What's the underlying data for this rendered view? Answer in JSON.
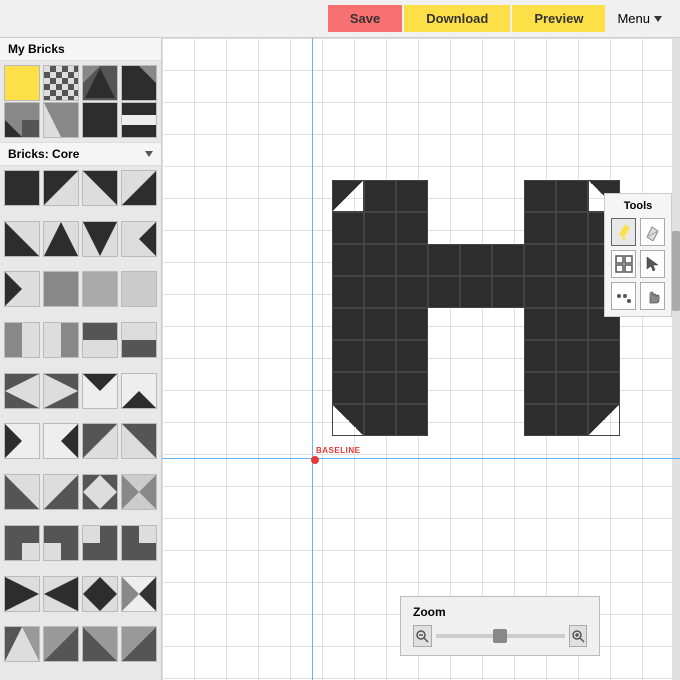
{
  "toolbar": {
    "save_label": "Save",
    "download_label": "Download",
    "preview_label": "Preview",
    "menu_label": "Menu"
  },
  "sidebar": {
    "my_bricks_title": "My Bricks",
    "bricks_core_title": "Bricks: Core"
  },
  "tools": {
    "title": "Tools"
  },
  "zoom": {
    "title": "Zoom",
    "minus": "−",
    "plus": "+"
  },
  "canvas": {
    "baseline_label": "BASELINE"
  }
}
